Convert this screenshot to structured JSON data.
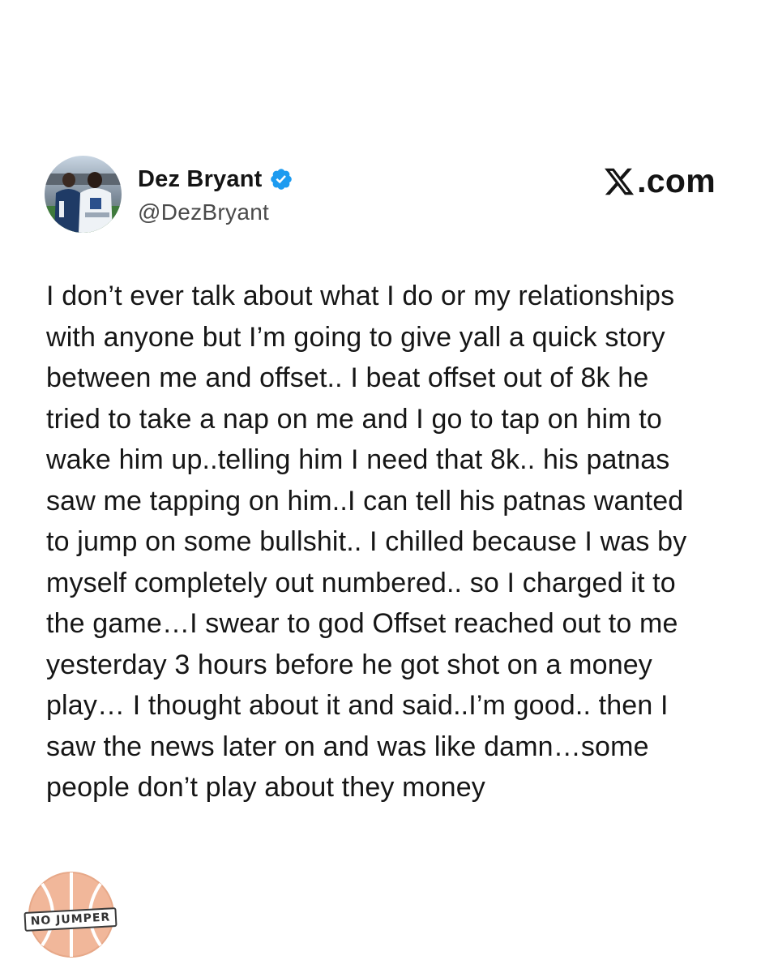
{
  "post": {
    "author": {
      "display_name": "Dez Bryant",
      "handle": "@DezBryant",
      "verified": true,
      "avatar_icon": "user-avatar-photo"
    },
    "brand": {
      "text": ".com",
      "logo_icon": "x-logo-icon"
    },
    "text_lines": [
      "I don’t ever talk about what I do or my relationships",
      "with anyone but I’m going to give yall a quick story",
      "between me and offset.. I beat offset out of 8k he",
      "tried to take a nap on me and I go to tap on him to",
      "wake him up..telling him I need that 8k.. his patnas",
      "saw me tapping on him..I can tell his patnas wanted",
      "to jump on some bullshit.. I chilled because I was by",
      "myself completely out numbered.. so I charged it to",
      "the game…I swear to god Offset reached out to me",
      "yesterday 3 hours before he got shot on a money",
      "play… I thought about it and said..I’m good.. then I",
      "saw the news later on and was like damn…some",
      "people don’t play about they money"
    ]
  },
  "watermark": {
    "label": "NO JUMPER",
    "icon": "basketball-icon"
  },
  "colors": {
    "verified_badge": "#1d9bf0",
    "text_primary": "#161616",
    "handle": "#4a4a4a",
    "watermark_ball": "#f1b79a",
    "background": "#ffffff"
  }
}
